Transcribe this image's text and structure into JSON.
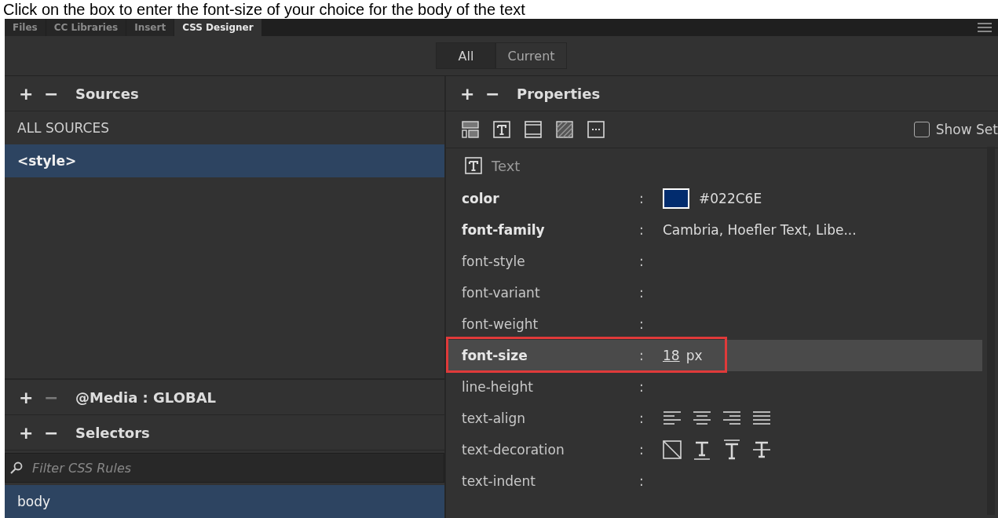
{
  "caption": "Click on the box to enter the font-size of your choice for the body of the text",
  "tabs": [
    {
      "label": "Files",
      "selected": false
    },
    {
      "label": "CC Libraries",
      "selected": false
    },
    {
      "label": "Insert",
      "selected": false
    },
    {
      "label": "CSS Designer",
      "selected": true
    }
  ],
  "mode_buttons": [
    {
      "label": "All",
      "selected": true
    },
    {
      "label": "Current",
      "selected": false
    }
  ],
  "sources": {
    "title": "Sources",
    "add": "+",
    "remove": "−",
    "items": [
      {
        "label": "ALL SOURCES",
        "selected": false
      },
      {
        "label": "<style>",
        "selected": true
      }
    ]
  },
  "media": {
    "title": "@Media :  GLOBAL",
    "add": "+",
    "remove": "−",
    "remove_disabled": true
  },
  "selectors": {
    "title": "Selectors",
    "add": "+",
    "remove": "−",
    "filter_placeholder": "Filter CSS Rules",
    "items": [
      {
        "label": "body",
        "selected": true
      }
    ]
  },
  "properties": {
    "title": "Properties",
    "separator": ":",
    "add": "+",
    "remove": "−",
    "show_set_label": "Show Set",
    "show_set_checked": false,
    "section_title": "Text",
    "rows": [
      {
        "kind": "color",
        "name": "color",
        "bold": true,
        "selected": false,
        "value": "#022C6E",
        "color": "#022c6e"
      },
      {
        "kind": "text",
        "name": "font-family",
        "bold": true,
        "selected": false,
        "value": "Cambria, Hoefler Text, Libe..."
      },
      {
        "kind": "text",
        "name": "font-style",
        "bold": false,
        "selected": false
      },
      {
        "kind": "text",
        "name": "font-variant",
        "bold": false,
        "selected": false
      },
      {
        "kind": "text",
        "name": "font-weight",
        "bold": false,
        "selected": false
      },
      {
        "kind": "number",
        "name": "font-size",
        "bold": true,
        "selected": true,
        "value": "18",
        "unit": "px"
      },
      {
        "kind": "text",
        "name": "line-height",
        "bold": false,
        "selected": false
      },
      {
        "kind": "align",
        "name": "text-align",
        "bold": false,
        "selected": false
      },
      {
        "kind": "decoration",
        "name": "text-decoration",
        "bold": false,
        "selected": false
      },
      {
        "kind": "text",
        "name": "text-indent",
        "bold": false,
        "selected": false
      }
    ]
  }
}
